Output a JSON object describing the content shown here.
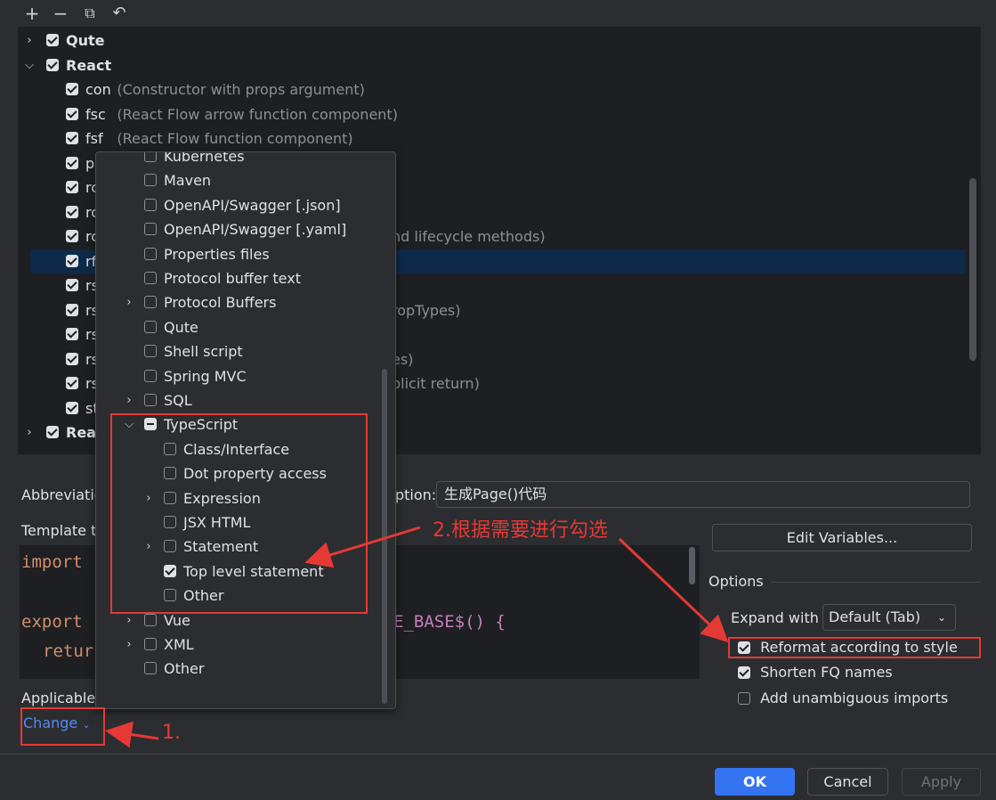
{
  "toolbar": {
    "add_icon": "plus-icon",
    "remove_icon": "minus-icon",
    "copy_icon": "copy-icon",
    "revert_icon": "undo-icon"
  },
  "tree": {
    "groups": [
      {
        "label": "Qute",
        "expanded": false,
        "checked": true
      },
      {
        "label": "React",
        "expanded": true,
        "checked": true
      }
    ],
    "items": [
      {
        "abbr": "con",
        "desc": "(Constructor with props argument)",
        "checked": true
      },
      {
        "abbr": "fsc",
        "desc": "(React Flow arrow function component)",
        "checked": true
      },
      {
        "abbr": "fsf",
        "desc": "(React Flow function component)",
        "checked": true
      },
      {
        "abbr": "p",
        "desc": "",
        "checked": true
      },
      {
        "abbr": "rc",
        "desc": "",
        "checked": true
      },
      {
        "abbr": "rc",
        "desc": "",
        "checked": true
      },
      {
        "abbr": "rc",
        "desc": "nd lifecycle methods)",
        "checked": true
      },
      {
        "abbr": "rf",
        "desc": "",
        "checked": true,
        "selected": true
      },
      {
        "abbr": "rs",
        "desc": "",
        "checked": true
      },
      {
        "abbr": "rs",
        "desc": "ropTypes)",
        "checked": true
      },
      {
        "abbr": "rs",
        "desc": "",
        "checked": true
      },
      {
        "abbr": "rs",
        "desc": "es)",
        "checked": true
      },
      {
        "abbr": "rs",
        "desc": "plicit return)",
        "checked": true
      },
      {
        "abbr": "st",
        "desc": "",
        "checked": true
      }
    ],
    "bottom_group": "Reac"
  },
  "popup": {
    "items": [
      {
        "label": "Kubernetes",
        "state": "off",
        "indent": 0,
        "chevron": false
      },
      {
        "label": "Maven",
        "state": "off",
        "indent": 0,
        "chevron": false
      },
      {
        "label": "OpenAPI/Swagger [.json]",
        "state": "off",
        "indent": 0,
        "chevron": false
      },
      {
        "label": "OpenAPI/Swagger [.yaml]",
        "state": "off",
        "indent": 0,
        "chevron": false
      },
      {
        "label": "Properties files",
        "state": "off",
        "indent": 0,
        "chevron": false
      },
      {
        "label": "Protocol buffer text",
        "state": "off",
        "indent": 0,
        "chevron": false
      },
      {
        "label": "Protocol Buffers",
        "state": "off",
        "indent": 0,
        "chevron": "right"
      },
      {
        "label": "Qute",
        "state": "off",
        "indent": 0,
        "chevron": false
      },
      {
        "label": "Shell script",
        "state": "off",
        "indent": 0,
        "chevron": false
      },
      {
        "label": "Spring MVC",
        "state": "off",
        "indent": 0,
        "chevron": false
      },
      {
        "label": "SQL",
        "state": "off",
        "indent": 0,
        "chevron": "right"
      },
      {
        "label": "TypeScript",
        "state": "mixed",
        "indent": 0,
        "chevron": "down"
      },
      {
        "label": "Class/Interface",
        "state": "off",
        "indent": 1,
        "chevron": false
      },
      {
        "label": "Dot property access",
        "state": "off",
        "indent": 1,
        "chevron": false
      },
      {
        "label": "Expression",
        "state": "off",
        "indent": 1,
        "chevron": "right"
      },
      {
        "label": "JSX HTML",
        "state": "off",
        "indent": 1,
        "chevron": false
      },
      {
        "label": "Statement",
        "state": "off",
        "indent": 1,
        "chevron": "right"
      },
      {
        "label": "Top level statement",
        "state": "on",
        "indent": 1,
        "chevron": false
      },
      {
        "label": "Other",
        "state": "off",
        "indent": 1,
        "chevron": false
      },
      {
        "label": "Vue",
        "state": "off",
        "indent": 0,
        "chevron": "right"
      },
      {
        "label": "XML",
        "state": "off",
        "indent": 0,
        "chevron": "right"
      },
      {
        "label": "Other",
        "state": "off",
        "indent": 0,
        "chevron": false
      }
    ]
  },
  "form": {
    "abbreviation_label": "Abbreviatio",
    "description_label": "ption:",
    "description_value": "生成Page()代码",
    "template_label": "Template t",
    "edit_variables": "Edit Variables...",
    "applicable_label": "Applicable",
    "change_link": "Change",
    "code_lines": [
      "import",
      "export",
      "retur",
      "E_BASE$() {"
    ]
  },
  "options": {
    "title": "Options",
    "expand_label": "Expand with",
    "expand_value": "Default (Tab)",
    "reformat": "Reformat according to style",
    "shorten": "Shorten FQ names",
    "add_imports": "Add unambiguous imports",
    "reformat_checked": true,
    "shorten_checked": true,
    "add_imports_checked": false
  },
  "footer": {
    "ok": "OK",
    "cancel": "Cancel",
    "apply": "Apply"
  },
  "annotations": {
    "step1": "1.",
    "step2": "2.根据需要进行勾选"
  },
  "colors": {
    "annotation": "#e53935",
    "accent": "#3574f0",
    "selection": "#0e2a48"
  }
}
